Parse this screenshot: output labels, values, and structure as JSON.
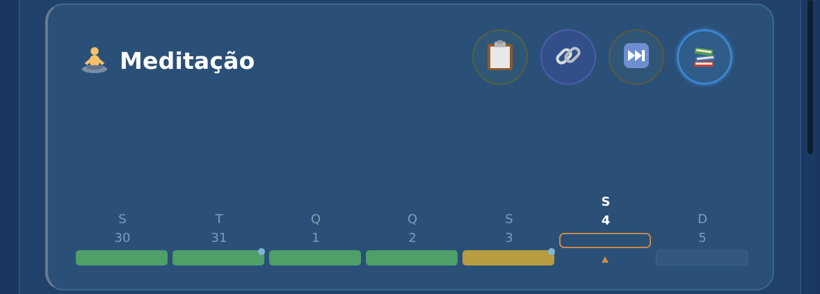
{
  "habit": {
    "title": "Meditação",
    "icon": "meditation-icon"
  },
  "actions": [
    {
      "name": "clipboard-icon"
    },
    {
      "name": "link-icon"
    },
    {
      "name": "skip-forward-icon"
    },
    {
      "name": "books-icon"
    }
  ],
  "days": [
    {
      "letter": "S",
      "number": "30",
      "status": "done",
      "today": false
    },
    {
      "letter": "T",
      "number": "31",
      "status": "done",
      "today": false,
      "dot": true
    },
    {
      "letter": "Q",
      "number": "1",
      "status": "done",
      "today": false
    },
    {
      "letter": "Q",
      "number": "2",
      "status": "done",
      "today": false
    },
    {
      "letter": "S",
      "number": "3",
      "status": "partial",
      "today": false,
      "dot": true
    },
    {
      "letter": "S",
      "number": "4",
      "status": "today",
      "today": true
    },
    {
      "letter": "D",
      "number": "5",
      "status": "future",
      "today": false
    }
  ],
  "colors": {
    "done": "#4f9f69",
    "partial": "#b79d3f",
    "today_outline": "#c88a4a",
    "accent": "#3c86d2"
  }
}
